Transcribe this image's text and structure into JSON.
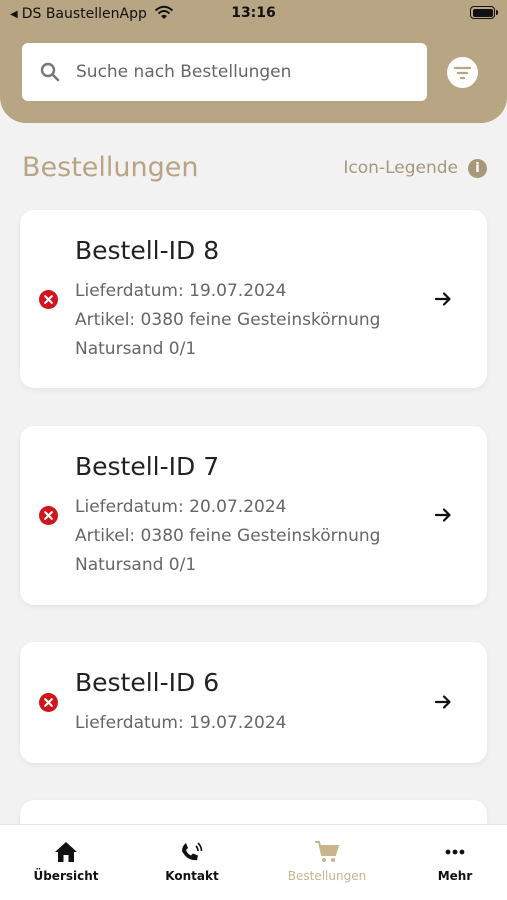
{
  "status_bar": {
    "back_app": "DS BaustellenApp",
    "time": "13:16"
  },
  "search": {
    "placeholder": "Suche nach Bestellungen",
    "value": ""
  },
  "section": {
    "title": "Bestellungen",
    "legend_label": "Icon-Legende"
  },
  "orders": [
    {
      "title": "Bestell-ID 8",
      "delivery": "Lieferdatum: 19.07.2024",
      "article_line1": "Artikel: 0380 feine Gesteinskörnung",
      "article_line2": "Natursand 0/1",
      "status_icon": "error-x-icon"
    },
    {
      "title": "Bestell-ID 7",
      "delivery": "Lieferdatum: 20.07.2024",
      "article_line1": "Artikel: 0380 feine Gesteinskörnung",
      "article_line2": "Natursand 0/1",
      "status_icon": "error-x-icon"
    },
    {
      "title": "Bestell-ID 6",
      "delivery": "Lieferdatum: 19.07.2024",
      "status_icon": "error-x-icon"
    }
  ],
  "tabs": [
    {
      "label": "Übersicht",
      "icon": "home-icon",
      "active": false
    },
    {
      "label": "Kontakt",
      "icon": "phone-icon",
      "active": false
    },
    {
      "label": "Bestellungen",
      "icon": "cart-icon",
      "active": true
    },
    {
      "label": "Mehr",
      "icon": "more-icon",
      "active": false
    }
  ],
  "colors": {
    "brand": "#b8a584",
    "error": "#d0151c",
    "background": "#f2f2f2"
  }
}
